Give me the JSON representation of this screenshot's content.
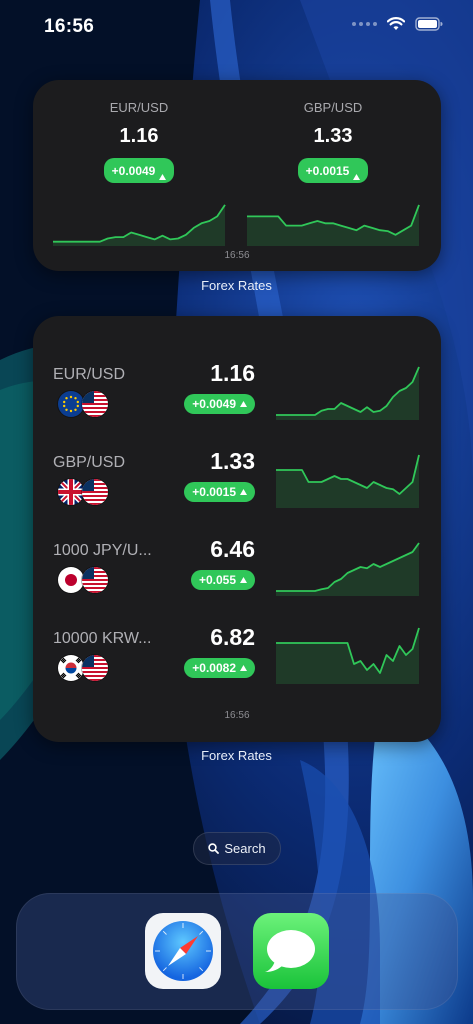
{
  "status": {
    "time": "16:56"
  },
  "small_widget": {
    "pairs": [
      {
        "name": "EUR/USD",
        "rate": "1.16",
        "change": "+0.0049",
        "trend_icon": "up-triangle-icon",
        "spark": [
          0.05,
          0.05,
          0.05,
          0.05,
          0.05,
          0.05,
          0.05,
          0.12,
          0.15,
          0.15,
          0.25,
          0.2,
          0.15,
          0.1,
          0.18,
          0.1,
          0.12,
          0.2,
          0.35,
          0.45,
          0.5,
          0.6,
          0.85
        ]
      },
      {
        "name": "GBP/USD",
        "rate": "1.33",
        "change": "+0.0015",
        "trend_icon": "up-triangle-icon",
        "spark": [
          0.6,
          0.6,
          0.6,
          0.6,
          0.6,
          0.4,
          0.4,
          0.4,
          0.45,
          0.5,
          0.45,
          0.45,
          0.4,
          0.35,
          0.3,
          0.4,
          0.35,
          0.3,
          0.28,
          0.2,
          0.3,
          0.4,
          0.85
        ]
      }
    ],
    "time": "16:56",
    "caption": "Forex Rates"
  },
  "large_widget": {
    "rows": [
      {
        "name": "EUR/USD",
        "rate": "1.16",
        "change": "+0.0049",
        "flags": [
          "eu-flag-icon",
          "us-flag-icon"
        ],
        "spark": [
          0.05,
          0.05,
          0.05,
          0.05,
          0.05,
          0.05,
          0.05,
          0.12,
          0.15,
          0.15,
          0.25,
          0.2,
          0.15,
          0.1,
          0.18,
          0.1,
          0.12,
          0.2,
          0.35,
          0.45,
          0.5,
          0.6,
          0.85
        ]
      },
      {
        "name": "GBP/USD",
        "rate": "1.33",
        "change": "+0.0015",
        "flags": [
          "uk-flag-icon",
          "us-flag-icon"
        ],
        "spark": [
          0.6,
          0.6,
          0.6,
          0.6,
          0.6,
          0.4,
          0.4,
          0.4,
          0.45,
          0.5,
          0.45,
          0.45,
          0.4,
          0.35,
          0.3,
          0.4,
          0.35,
          0.3,
          0.28,
          0.2,
          0.3,
          0.4,
          0.85
        ]
      },
      {
        "name": "1000 JPY/U...",
        "rate": "6.46",
        "change": "+0.055",
        "flags": [
          "japan-flag-icon",
          "us-flag-icon"
        ],
        "spark": [
          0.05,
          0.05,
          0.05,
          0.05,
          0.05,
          0.05,
          0.05,
          0.08,
          0.1,
          0.2,
          0.25,
          0.35,
          0.4,
          0.45,
          0.43,
          0.5,
          0.45,
          0.5,
          0.55,
          0.6,
          0.65,
          0.7,
          0.85
        ]
      },
      {
        "name": "10000 KRW...",
        "rate": "6.82",
        "change": "+0.0082",
        "flags": [
          "korea-flag-icon",
          "us-flag-icon"
        ],
        "spark": [
          0.65,
          0.65,
          0.65,
          0.65,
          0.65,
          0.65,
          0.65,
          0.65,
          0.65,
          0.65,
          0.65,
          0.65,
          0.3,
          0.35,
          0.2,
          0.3,
          0.15,
          0.45,
          0.35,
          0.6,
          0.45,
          0.55,
          0.9
        ]
      }
    ],
    "time": "16:56",
    "caption": "Forex Rates"
  },
  "search": {
    "label": "Search",
    "icon": "search-icon"
  },
  "dock": {
    "apps": [
      {
        "name": "Safari",
        "icon": "safari-icon"
      },
      {
        "name": "Messages",
        "icon": "messages-icon"
      }
    ]
  },
  "colors": {
    "positive": "#30c759",
    "widget_bg": "#1c1c1e",
    "muted": "#8e8e93"
  }
}
